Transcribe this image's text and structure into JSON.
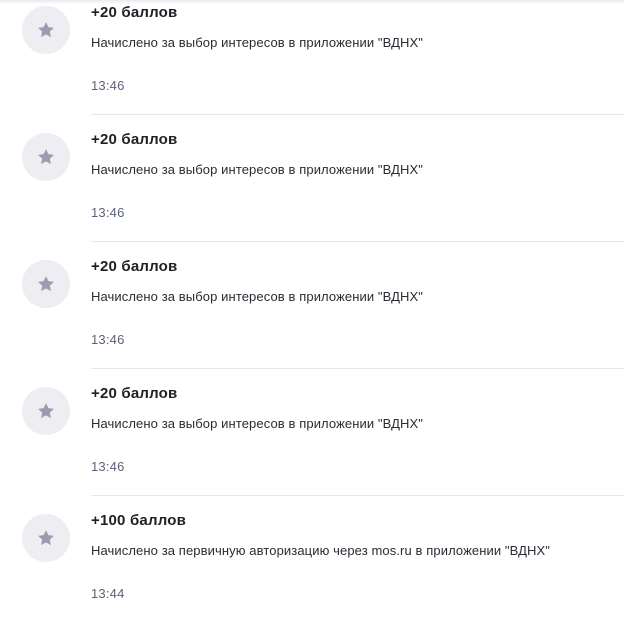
{
  "notifications": [
    {
      "title": "+20 баллов",
      "description": "Начислено за выбор интересов в приложении \"ВДНХ\"",
      "time": "13:46",
      "icon": "star-icon"
    },
    {
      "title": "+20 баллов",
      "description": "Начислено за выбор интересов в приложении \"ВДНХ\"",
      "time": "13:46",
      "icon": "star-icon"
    },
    {
      "title": "+20 баллов",
      "description": "Начислено за выбор интересов в приложении \"ВДНХ\"",
      "time": "13:46",
      "icon": "star-icon"
    },
    {
      "title": "+20 баллов",
      "description": "Начислено за выбор интересов в приложении \"ВДНХ\"",
      "time": "13:46",
      "icon": "star-icon"
    },
    {
      "title": "+100 баллов",
      "description": "Начислено за первичную авторизацию через mos.ru в приложении \"ВДНХ\"",
      "time": "13:44",
      "icon": "star-icon"
    }
  ],
  "colors": {
    "icon_bg": "#ededf2",
    "icon_fg": "#9a9db0",
    "title": "#1f1f25",
    "time": "#5d6278",
    "divider": "#e6e6ec"
  }
}
